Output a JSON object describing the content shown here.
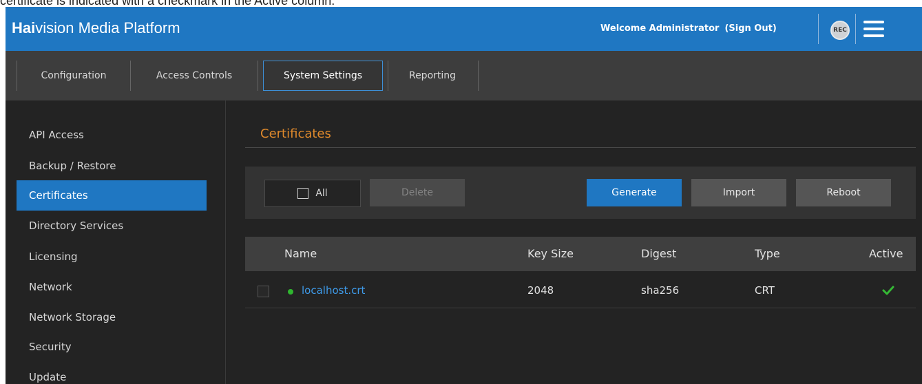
{
  "caption": "certificate is indicated with a checkmark in the Active column.",
  "header": {
    "brand_bold": "Hai",
    "brand_rest": "vision Media Platform",
    "welcome": "Welcome Administrator",
    "sign_out": "(Sign Out)",
    "rec_label": "REC",
    "menu_icon": "hamburger-menu-icon"
  },
  "tabs": [
    {
      "label": "Configuration",
      "active": false
    },
    {
      "label": "Access Controls",
      "active": false
    },
    {
      "label": "System Settings",
      "active": true
    },
    {
      "label": "Reporting",
      "active": false
    }
  ],
  "sidebar": {
    "items": [
      {
        "label": "API Access"
      },
      {
        "label": "Backup / Restore"
      },
      {
        "label": "Certificates",
        "active": true
      },
      {
        "label": "Directory Services"
      },
      {
        "label": "Licensing"
      },
      {
        "label": "Network"
      },
      {
        "label": "Network Storage"
      },
      {
        "label": "Security"
      },
      {
        "label": "Update"
      }
    ]
  },
  "main": {
    "title": "Certificates",
    "toolbar": {
      "all_label": "All",
      "delete_label": "Delete",
      "generate_label": "Generate",
      "import_label": "Import",
      "reboot_label": "Reboot"
    },
    "table": {
      "columns": [
        "Name",
        "Key Size",
        "Digest",
        "Type",
        "Active"
      ],
      "rows": [
        {
          "name": "localhost.crt",
          "key_size": "2048",
          "digest": "sha256",
          "type": "CRT",
          "active": true,
          "status": "green"
        }
      ]
    }
  },
  "colors": {
    "accent": "#1f77c2",
    "title_orange": "#e08a2c",
    "link_blue": "#3e9bea",
    "status_green": "#2fb62f",
    "check_green": "#35b935"
  }
}
